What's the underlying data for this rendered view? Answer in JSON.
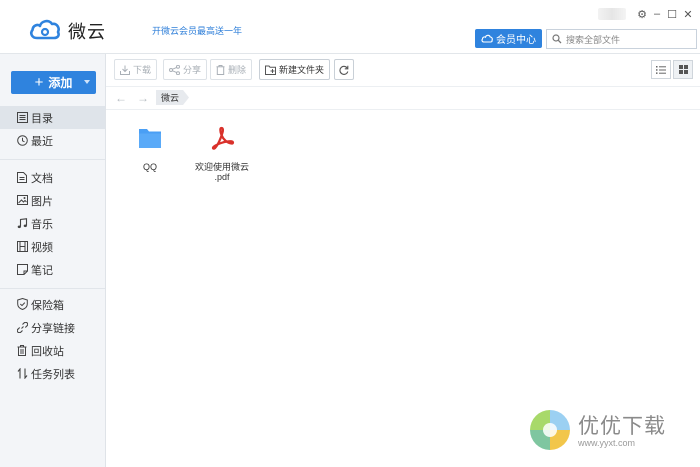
{
  "app": {
    "name": "微云",
    "promo": "开微云会员最高送一年",
    "member_center": "会员中心",
    "search_placeholder": "搜索全部文件",
    "window": {
      "settings": "⚙",
      "minimize": "–",
      "maximize": "☐",
      "close": "✕"
    }
  },
  "sidebar": {
    "add_label": "添加",
    "items": [
      {
        "label": "目录",
        "icon": "list-icon",
        "active": true
      },
      {
        "label": "最近",
        "icon": "clock-icon"
      },
      {
        "label": "文档",
        "icon": "doc-icon"
      },
      {
        "label": "图片",
        "icon": "image-icon"
      },
      {
        "label": "音乐",
        "icon": "music-icon"
      },
      {
        "label": "视频",
        "icon": "video-icon"
      },
      {
        "label": "笔记",
        "icon": "note-icon"
      },
      {
        "label": "保险箱",
        "icon": "shield-icon"
      },
      {
        "label": "分享链接",
        "icon": "link-icon"
      },
      {
        "label": "回收站",
        "icon": "trash-icon"
      },
      {
        "label": "任务列表",
        "icon": "transfer-icon"
      }
    ]
  },
  "toolbar": {
    "download": "下载",
    "share": "分享",
    "delete": "删除",
    "new_folder": "新建文件夹"
  },
  "breadcrumb": {
    "current": "微云"
  },
  "files": [
    {
      "name": "QQ",
      "type": "folder"
    },
    {
      "name": "欢迎使用微云",
      "ext": ".pdf",
      "type": "pdf"
    }
  ],
  "watermark": {
    "text": "优优下载",
    "url": "www.yyxt.com"
  },
  "colors": {
    "accent": "#2f83de",
    "folder": "#4a9ff5",
    "pdf": "#d9312b",
    "sidebar_bg": "#f3f5f8"
  }
}
